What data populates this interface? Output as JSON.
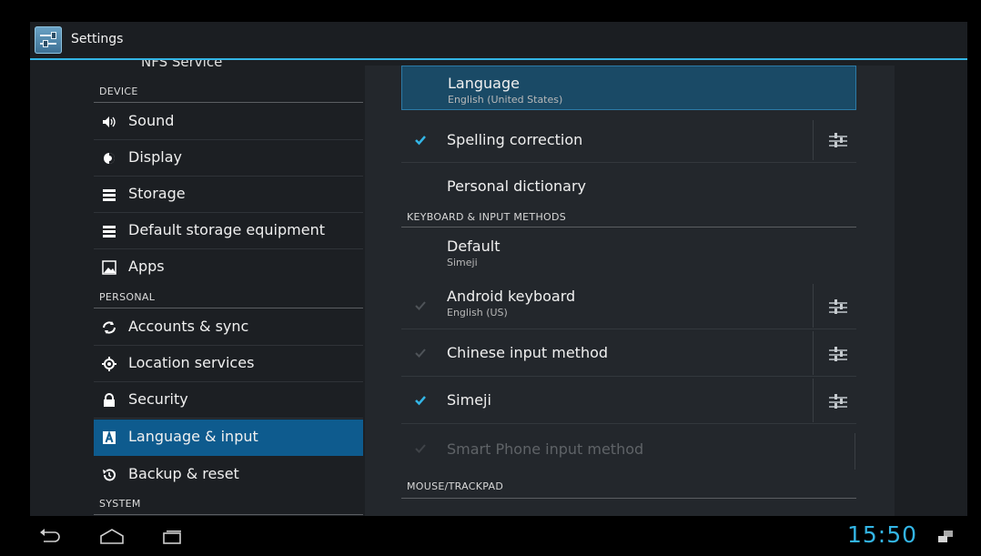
{
  "actionbar": {
    "title": "Settings",
    "icon": "settings-app-icon"
  },
  "left": {
    "nfs_label": "NFS Service",
    "headers": {
      "device": "DEVICE",
      "personal": "PERSONAL",
      "system": "SYSTEM"
    },
    "items": [
      {
        "label": "Sound",
        "icon": "speaker-icon"
      },
      {
        "label": "Display",
        "icon": "brightness-icon"
      },
      {
        "label": "Storage",
        "icon": "storage-icon"
      },
      {
        "label": "Default storage equipment",
        "icon": "storage-icon"
      },
      {
        "label": "Apps",
        "icon": "apps-icon"
      },
      {
        "label": "Accounts & sync",
        "icon": "sync-icon"
      },
      {
        "label": "Location services",
        "icon": "location-icon"
      },
      {
        "label": "Security",
        "icon": "lock-icon"
      },
      {
        "label": "Language & input",
        "icon": "language-icon",
        "selected": true
      },
      {
        "label": "Backup & reset",
        "icon": "backup-icon"
      }
    ]
  },
  "right": {
    "language": {
      "title": "Language",
      "summary": "English (United States)"
    },
    "spelling": {
      "title": "Spelling correction",
      "checked": true
    },
    "personal_dictionary": {
      "title": "Personal dictionary"
    },
    "keyboard_header": "KEYBOARD & INPUT METHODS",
    "default": {
      "title": "Default",
      "summary": "Simeji"
    },
    "android_keyboard": {
      "title": "Android keyboard",
      "summary": "English (US)",
      "checked": true
    },
    "chinese": {
      "title": "Chinese input method",
      "checked": true
    },
    "simeji": {
      "title": "Simeji",
      "checked": true
    },
    "smartphone": {
      "title": "Smart Phone input method",
      "checked": true,
      "enabled": false
    },
    "mouse_header": "MOUSE/TRACKPAD"
  },
  "statusbar": {
    "time": "15:50"
  },
  "colors": {
    "accent": "#33b5e5",
    "selected": "#0e5b8e"
  }
}
